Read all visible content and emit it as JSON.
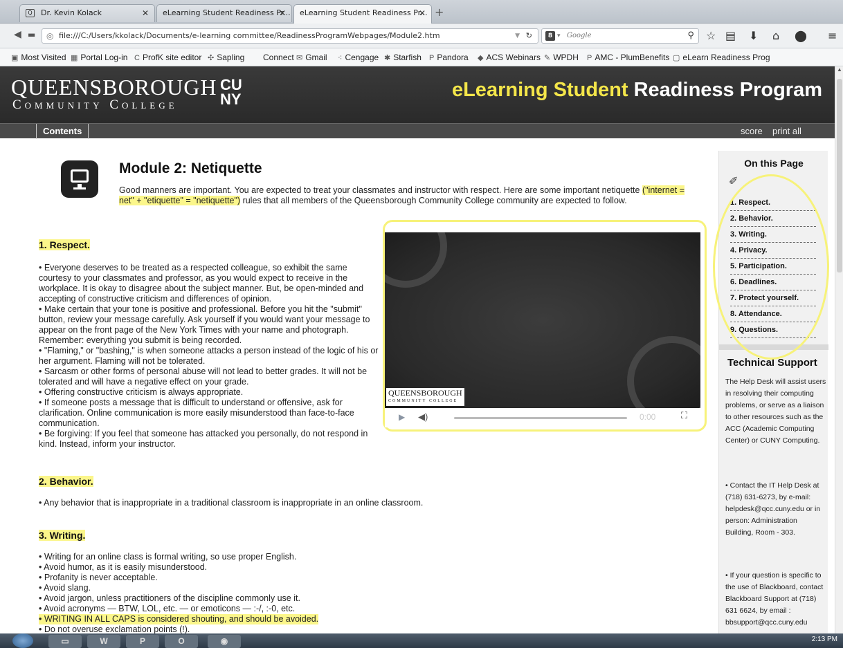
{
  "browser": {
    "tabs": [
      {
        "label": "Dr. Kevin Kolack",
        "active": false
      },
      {
        "label": "eLearning Student Readiness Pr...",
        "active": false
      },
      {
        "label": "eLearning Student Readiness Pr...",
        "active": true
      }
    ],
    "new_tab": "+",
    "url": "file:///C:/Users/kkolack/Documents/e-learning committee/ReadinessProgramWebpages/Module2.htm",
    "search_placeholder": "Google",
    "bookmarks": [
      "Most Visited",
      "Portal Log-in",
      "ProfK site editor",
      "Sapling",
      "Connect",
      "Gmail",
      "Cengage",
      "Starfish",
      "Pandora",
      "ACS Webinars",
      "WPDH",
      "AMC - PlumBenefits",
      "eLearn Readiness Prog"
    ]
  },
  "header": {
    "logo_main": "QUEENSBOROUGH",
    "logo_sub": "Community College",
    "logo_cuny": "CU NY",
    "title_accent": "eLearning Student",
    "title_rest": "Readiness Program",
    "menu_contents": "Contents",
    "menu_score": "score",
    "menu_print": "print all"
  },
  "module": {
    "title": "Module 2: Netiquette",
    "intro_start": "Good manners are important. You are expected to treat your classmates and instructor with respect. Here are some important netiquette ",
    "intro_hl": "(\"internet = net\" + \"etiquette\" = \"netiquette\")",
    "intro_end": " rules that all members of the Queensborough Community College community are expected to follow."
  },
  "sections": {
    "respect": {
      "heading": "1. Respect.",
      "items": [
        "• Everyone deserves to be treated as a respected colleague, so exhibit the same courtesy to your classmates and professor, as you would expect to receive in the workplace. It is okay to disagree about the subject manner. But, be open-minded and accepting of constructive criticism and differences of opinion.",
        "• Make certain that your tone is positive and professional. Before you hit the \"submit\" button, review your message carefully. Ask yourself if you would want your message to appear on the front page of the New York Times with your name and photograph. Remember: everything you submit is being recorded.",
        "• \"Flaming,\" or \"bashing,\" is when someone attacks a person instead of the logic of his or her argument. Flaming will not be tolerated.",
        "• Sarcasm or other forms of personal abuse will not lead to better grades. It will not be tolerated and will have a negative effect on your grade.",
        "• Offering constructive criticism is always appropriate.",
        "• If someone posts a message that is difficult to understand or offensive, ask for clarification. Online communication is more easily misunderstood than face-to-face communication.",
        "• Be forgiving: If you feel that someone has attacked you personally, do not respond in kind. Instead, inform your instructor."
      ]
    },
    "behavior": {
      "heading": "2. Behavior.",
      "items": [
        "• Any behavior that is inappropriate in a traditional classroom is inappropriate in an online classroom."
      ]
    },
    "writing": {
      "heading": "3. Writing.",
      "items": [
        "• Writing for an online class is formal writing, so use proper English.",
        "• Avoid humor, as it is easily misunderstood.",
        "• Profanity is never acceptable.",
        "• Avoid slang.",
        "• Avoid jargon, unless practitioners of the discipline commonly use it.",
        "• Avoid acronyms — BTW, LOL, etc. — or emoticons — :-/, :-0, etc.",
        "• WRITING IN ALL CAPS is considered shouting, and should be avoided.",
        "• Do not overuse exclamation points (!)."
      ]
    }
  },
  "video": {
    "logo": "QUEENSBOROUGH",
    "logo_sub": "COMMUNITY COLLEGE",
    "time": "0:00"
  },
  "sidebar": {
    "title": "On this Page",
    "links": [
      "1. Respect.",
      "2. Behavior.",
      "3. Writing.",
      "4. Privacy.",
      "5. Participation.",
      "6. Deadlines.",
      "7. Protect yourself.",
      "8. Attendance.",
      "9. Questions."
    ],
    "support_title": "Technical Support",
    "support_intro": "The Help Desk will assist users in resolving their computing problems, or serve as a liaison to other resources such as the ACC (Academic Computing Center) or CUNY Computing.",
    "support_contact": "• Contact the IT Help Desk at (718) 631-6273, by e-mail: helpdesk@qcc.cuny.edu or in person: Administration Building, Room - 303.",
    "support_bb": "• If your question is specific to the use of Blackboard, contact Blackboard Support at (718) 631 6624, by email : bbsupport@qcc.cuny.edu"
  },
  "taskbar": {
    "time": "2:13 PM"
  },
  "colors": {
    "highlight": "#fbf68a",
    "header_bg": "#2e2e2e",
    "title_accent": "#f4e64a"
  }
}
